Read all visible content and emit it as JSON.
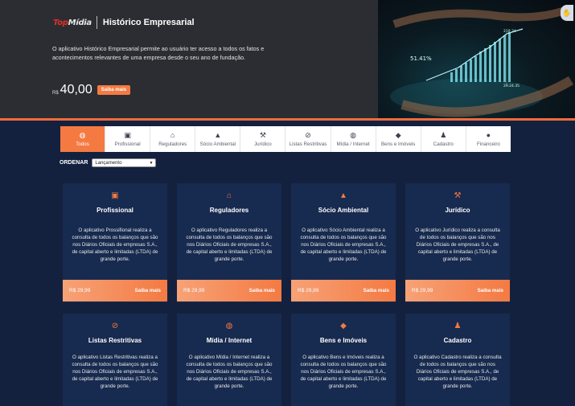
{
  "hero": {
    "logo": "TopMídia",
    "title": "Histórico Empresarial",
    "description": "O aplicativo Histórico Empresarial permite ao usuário ter acesso a todos os fatos e acontecimentos relevantes de uma empresa desde o seu ano de fundação.",
    "currency": "R$",
    "price": "40,00",
    "button": "Saiba mais",
    "chart_readouts": [
      "219.34",
      "51.41%",
      "29.24.35"
    ]
  },
  "tabs": [
    {
      "label": "Todos",
      "icon": "globe-icon",
      "glyph": "◍"
    },
    {
      "label": "Profissional",
      "icon": "briefcase-icon",
      "glyph": "▣"
    },
    {
      "label": "Reguladores",
      "icon": "bank-icon",
      "glyph": "⌂"
    },
    {
      "label": "Sócio Ambiental",
      "icon": "bell-icon",
      "glyph": "▲"
    },
    {
      "label": "Jurídico",
      "icon": "gavel-icon",
      "glyph": "⚒"
    },
    {
      "label": "Listas Restritivas",
      "icon": "ban-icon",
      "glyph": "⊘"
    },
    {
      "label": "Mídia / Internet",
      "icon": "globe-icon",
      "glyph": "◍"
    },
    {
      "label": "Bens e Imóveis",
      "icon": "diamond-icon",
      "glyph": "◆"
    },
    {
      "label": "Cadastro",
      "icon": "person-icon",
      "glyph": "♟"
    },
    {
      "label": "Financeiro",
      "icon": "piggy-bank-icon",
      "glyph": "●"
    }
  ],
  "sort": {
    "label": "ORDENAR",
    "value": "Lançamento"
  },
  "cards": [
    {
      "title": "Profissional",
      "icon": "briefcase-icon",
      "glyph": "▣",
      "description": "O aplicativo Prossifional realiza a consulta de todos os balanços que são nos Diários Oficiais de empresas S.A., de capital aberto e limitadas (LTDA) de grande porte.",
      "price": "R$ 29,99",
      "button": "Saiba mais"
    },
    {
      "title": "Reguladores",
      "icon": "bank-icon",
      "glyph": "⌂",
      "description": "O aplicativo Reguladores realiza a consulta de todos os balanços que são nos Diários Oficiais de empresas S.A., de capital aberto e limitadas (LTDA) de grande porte.",
      "price": "R$ 29,99",
      "button": "Saiba mais"
    },
    {
      "title": "Sócio Ambiental",
      "icon": "bell-icon",
      "glyph": "▲",
      "description": "O aplicativo Sócio Ambiental realiza a consulta de todos os balanços que são nos Diários Oficiais de empresas S.A., de capital aberto e limitadas (LTDA) de grande porte.",
      "price": "R$ 29,99",
      "button": "Saiba mais"
    },
    {
      "title": "Jurídico",
      "icon": "gavel-icon",
      "glyph": "⚒",
      "description": "O aplicativo Jurídico realiza a consulta de todos os balanços que são nos Diários Oficiais de empresas S.A., de capital aberto e limitadas (LTDA) de grande porte.",
      "price": "R$ 29,99",
      "button": "Saiba mais"
    },
    {
      "title": "Listas Restritivas",
      "icon": "ban-icon",
      "glyph": "⊘",
      "description": "O aplicativo Listas Restritivas realiza a consulta de todos os balanços que são nos Diários Oficiais de empresas S.A., de capital aberto e limitadas (LTDA) de grande porte."
    },
    {
      "title": "Mídia / Internet",
      "icon": "globe-icon",
      "glyph": "◍",
      "description": "O aplicativo Mídia / Internet realiza a consulta de todos os balanços que são nos Diários Oficiais de empresas S.A., de capital aberto e limitadas (LTDA) de grande porte."
    },
    {
      "title": "Bens e Imóveis",
      "icon": "diamond-icon",
      "glyph": "◆",
      "description": "O aplicativo Bens e Imóveis realiza a consulta de todos os balanços que são nos Diários Oficiais de empresas S.A., de capital aberto e limitadas (LTDA) de grande porte."
    },
    {
      "title": "Cadastro",
      "icon": "person-icon",
      "glyph": "♟",
      "description": "O aplicativo Cadastro realiza a consulta de todos os balanços que são nos Diários Oficiais de empresas S.A., de capital aberto e limitadas (LTDA) de grande porte."
    }
  ],
  "colors": {
    "accent": "#f47a42",
    "background": "#13213f",
    "card": "#172a4f",
    "hero": "#2b2d32"
  }
}
